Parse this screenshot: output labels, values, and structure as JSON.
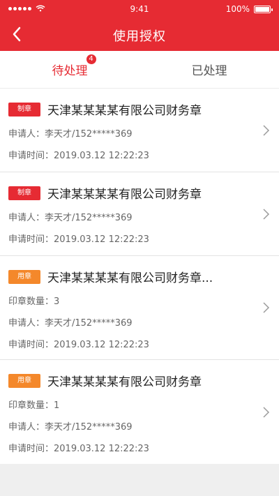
{
  "status_bar": {
    "time": "9:41",
    "battery": "100%"
  },
  "header": {
    "title": "使用授权"
  },
  "tabs": [
    {
      "label": "待处理",
      "badge": "4"
    },
    {
      "label": "已处理"
    }
  ],
  "requests": [
    {
      "tag": "制章",
      "title": "天津某某某某有限公司财务章",
      "applicant": "申请人：李天才/152*****369",
      "time": "申请时间：2019.03.12 12:22:23"
    },
    {
      "tag": "制章",
      "title": "天津某某某某有限公司财务章",
      "applicant": "申请人：李天才/152*****369",
      "time": "申请时间：2019.03.12 12:22:23"
    },
    {
      "tag": "用章",
      "title": "天津某某某某有限公司财务章...",
      "quantity": "印章数量：3",
      "applicant": "申请人：李天才/152*****369",
      "time": "申请时间：2019.03.12 12:22:23"
    },
    {
      "tag": "用章",
      "title": "天津某某某某有限公司财务章",
      "quantity": "印章数量：1",
      "applicant": "申请人：李天才/152*****369",
      "time": "申请时间：2019.03.12 12:22:23"
    }
  ],
  "colors": {
    "primary": "#e62b33",
    "orange": "#f4882b"
  }
}
